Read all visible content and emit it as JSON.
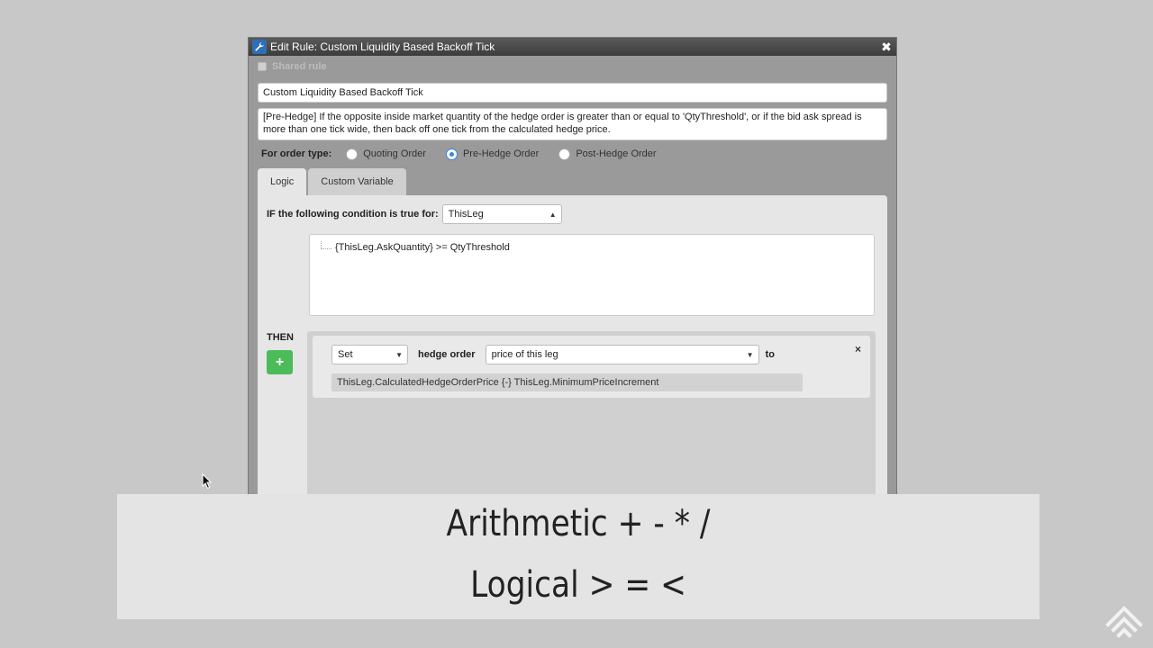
{
  "dialog": {
    "title": "Edit Rule: Custom Liquidity Based Backoff Tick",
    "close_label": "✖",
    "shared_rule_label": "Shared rule",
    "rule_name": "Custom Liquidity Based Backoff Tick",
    "rule_description": "[Pre-Hedge] If the opposite inside market quantity of the hedge order is greater than or equal to 'QtyThreshold', or if the bid ask spread is more than one tick wide, then back off one tick from the calculated hedge price."
  },
  "order_type": {
    "label": "For order type:",
    "options": [
      {
        "label": "Quoting Order",
        "selected": false
      },
      {
        "label": "Pre-Hedge Order",
        "selected": true
      },
      {
        "label": "Post-Hedge Order",
        "selected": false
      }
    ]
  },
  "tabs": [
    {
      "label": "Logic",
      "active": true
    },
    {
      "label": "Custom Variable",
      "active": false
    }
  ],
  "logic": {
    "condition_label": "IF the following condition is true for:",
    "condition_target": "ThisLeg",
    "condition_expression": "{ThisLeg.AskQuantity} >= QtyThreshold",
    "then_label": "THEN",
    "add_label": "+",
    "action": {
      "verb": "Set",
      "object_label": "hedge order",
      "property": "price of this leg",
      "to_label": "to",
      "remove_label": "×",
      "expression": "ThisLeg.CalculatedHedgeOrderPrice {-} ThisLeg.MinimumPriceIncrement"
    }
  },
  "overlay": {
    "line1": "Arithmetic  + - * /",
    "line2": "Logical  > = <"
  },
  "colors": {
    "background": "#c8c8c8",
    "add_button": "#4cbb59",
    "radio_selected": "#3b86d8",
    "titlebar": "#3c3c3c"
  }
}
